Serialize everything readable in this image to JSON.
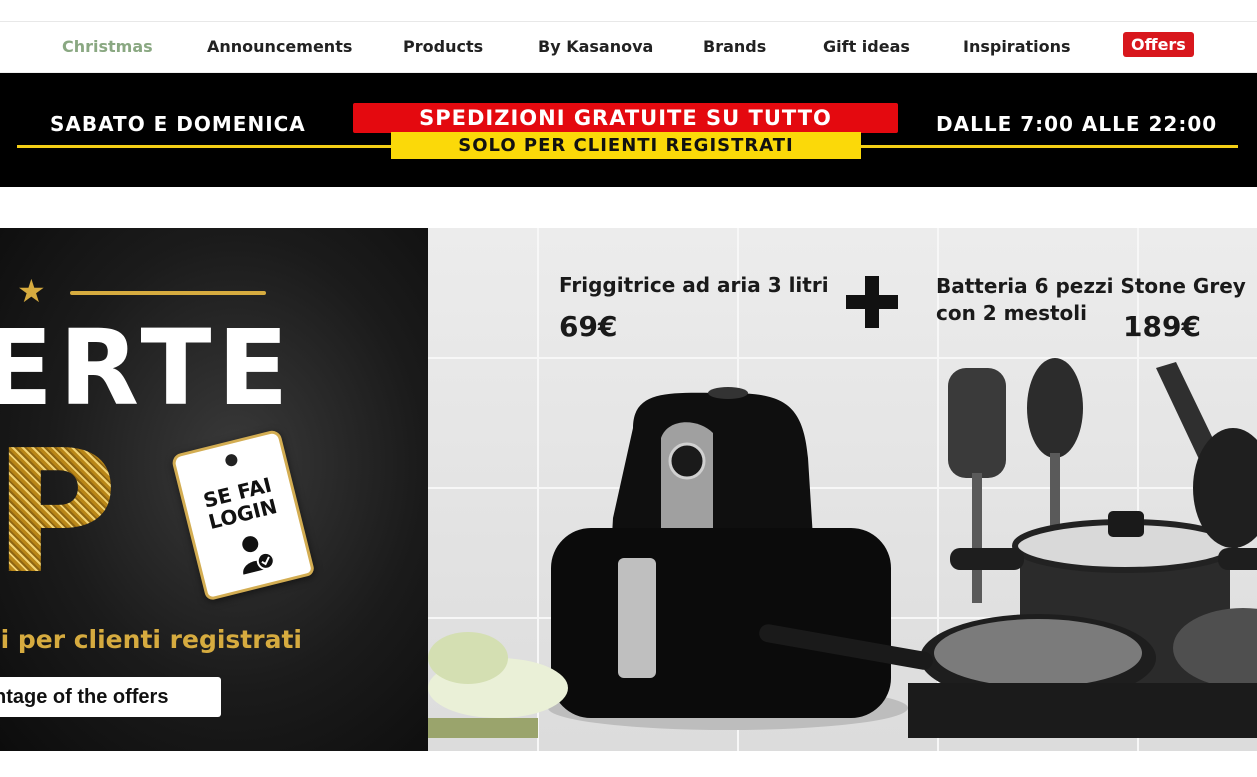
{
  "nav": {
    "items": [
      "Christmas",
      "Announcements",
      "Products",
      "By Kasanova",
      "Brands",
      "Gift ideas",
      "Inspirations"
    ],
    "offers": "Offers"
  },
  "promo": {
    "left": "SABATO E DOMENICA",
    "red": "SPEDIZIONI GRATUITE SU TUTTO",
    "yellow": "SOLO PER CLIENTI REGISTRATI",
    "right": "DALLE 7:00 ALLE 22:00"
  },
  "hero": {
    "big_word": "ERTE",
    "gold_word": "IP",
    "tag_text": "SE FAI LOGIN",
    "subtitle": "li per clienti registrati",
    "cta": "ntage of the offers"
  },
  "products": {
    "p1_name": "Friggitrice ad aria 3 litri",
    "p1_price": "69€",
    "p2_name": "Batteria 6 pezzi Stone Grey con 2 mestoli",
    "p2_price": "189€"
  },
  "colors": {
    "accent_red": "#d8171d",
    "gold": "#d6ab3f",
    "promo_yellow": "#fbd909"
  }
}
